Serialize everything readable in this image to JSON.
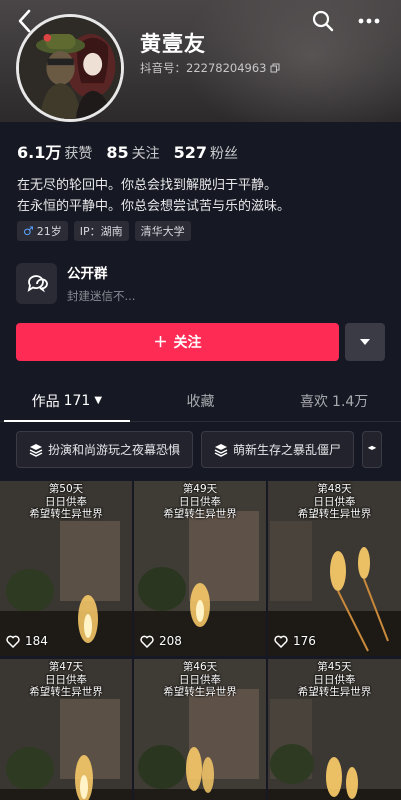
{
  "profile": {
    "username": "黄壹友",
    "douyin_id": "抖音号：22278204963"
  },
  "stats": [
    {
      "num": "6.1万",
      "label": "获赞"
    },
    {
      "num": "85",
      "label": "关注"
    },
    {
      "num": "527",
      "label": "粉丝"
    }
  ],
  "bio": {
    "line1": "在无尽的轮回中。你总会找到解脱归于平静。",
    "line2": "在永恒的平静中。你总会想尝试苦与乐的滋味。"
  },
  "tags": {
    "age": "21岁",
    "ip": "IP：湖南",
    "school": "清华大学"
  },
  "group": {
    "title": "公开群",
    "subtitle": "封建迷信不..."
  },
  "follow_label": "关注",
  "tabs": [
    {
      "label": "作品",
      "count": "171"
    },
    {
      "label": "收藏"
    },
    {
      "label": "喜欢",
      "count": "1.4万"
    }
  ],
  "collections": [
    "扮演和尚游玩之夜幕恐惧",
    "萌新生存之暴乱僵尸"
  ],
  "videos": [
    {
      "caption": "第50天\n日日供奉\n希望转生异世界",
      "likes": "184"
    },
    {
      "caption": "第49天\n日日供奉\n希望转生异世界",
      "likes": "208"
    },
    {
      "caption": "第48天\n日日供奉\n希望转生异世界",
      "likes": "176"
    },
    {
      "caption": "第47天\n日日供奉\n希望转生异世界",
      "likes": ""
    },
    {
      "caption": "第46天\n日日供奉\n希望转生异世界",
      "likes": ""
    },
    {
      "caption": "第45天\n日日供奉\n希望转生异世界",
      "likes": ""
    }
  ],
  "colors": {
    "accent": "#fe2c55",
    "background": "#161823"
  }
}
